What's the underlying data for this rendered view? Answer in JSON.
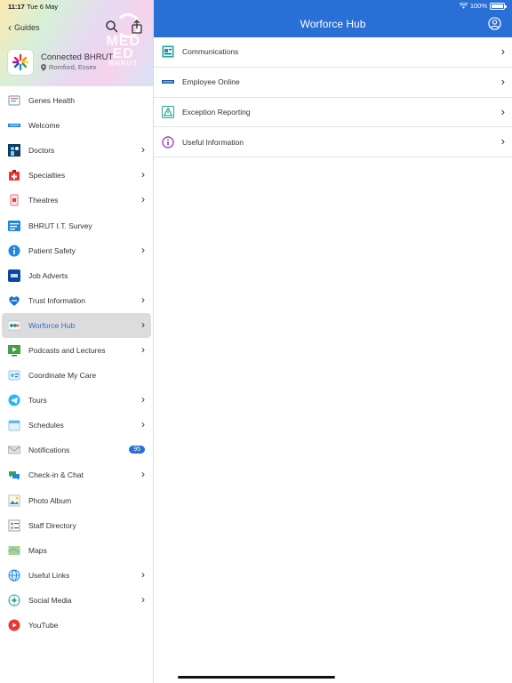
{
  "status_bar": {
    "time": "11:17",
    "date": "Tue 6 May",
    "battery": "100%"
  },
  "sidebar": {
    "back_label": "Guides",
    "app_name": "Connected BHRUT",
    "app_location": "Romford, Essex",
    "watermark_line1": "MED",
    "watermark_line2": "ED",
    "watermark_line3": "BHRUT",
    "items": [
      {
        "label": "Genes Health",
        "icon": "genes-health-icon",
        "chevron": false
      },
      {
        "label": "Welcome",
        "icon": "welcome-icon",
        "chevron": false
      },
      {
        "label": "Doctors",
        "icon": "doctors-icon",
        "chevron": true
      },
      {
        "label": "Specialties",
        "icon": "specialties-icon",
        "chevron": true
      },
      {
        "label": "Theatres",
        "icon": "theatres-icon",
        "chevron": true
      },
      {
        "label": "BHRUT I.T. Survey",
        "icon": "survey-icon",
        "chevron": false
      },
      {
        "label": "Patient Safety",
        "icon": "info-icon",
        "chevron": true
      },
      {
        "label": "Job Adverts",
        "icon": "job-adverts-icon",
        "chevron": false
      },
      {
        "label": "Trust Information",
        "icon": "trust-icon",
        "chevron": true
      },
      {
        "label": "Worforce Hub",
        "icon": "workforce-icon",
        "chevron": true,
        "active": true
      },
      {
        "label": "Podcasts and Lectures",
        "icon": "podcast-icon",
        "chevron": true
      },
      {
        "label": "Coordinate My Care",
        "icon": "care-icon",
        "chevron": false
      },
      {
        "label": "Tours",
        "icon": "telegram-icon",
        "chevron": true
      },
      {
        "label": "Schedules",
        "icon": "schedules-icon",
        "chevron": true
      },
      {
        "label": "Notifications",
        "icon": "mail-icon",
        "chevron": false,
        "badge": "95"
      },
      {
        "label": "Check-in & Chat",
        "icon": "chat-icon",
        "chevron": true
      },
      {
        "label": "Photo Album",
        "icon": "photo-icon",
        "chevron": false
      },
      {
        "label": "Staff Directory",
        "icon": "directory-icon",
        "chevron": false
      },
      {
        "label": "Maps",
        "icon": "map-icon",
        "chevron": false
      },
      {
        "label": "Useful Links",
        "icon": "globe-icon",
        "chevron": true
      },
      {
        "label": "Social Media",
        "icon": "social-icon",
        "chevron": true
      },
      {
        "label": "YouTube",
        "icon": "youtube-icon",
        "chevron": false
      }
    ]
  },
  "main": {
    "title": "Worforce Hub",
    "items": [
      {
        "label": "Communications",
        "icon": "communications-icon"
      },
      {
        "label": "Employee Online",
        "icon": "employee-online-icon"
      },
      {
        "label": "Exception Reporting",
        "icon": "exception-icon"
      },
      {
        "label": "Useful Information",
        "icon": "info-circle-icon"
      }
    ]
  },
  "colors": {
    "accent": "#2a6fd6",
    "active_bg": "#dcdcdc"
  }
}
